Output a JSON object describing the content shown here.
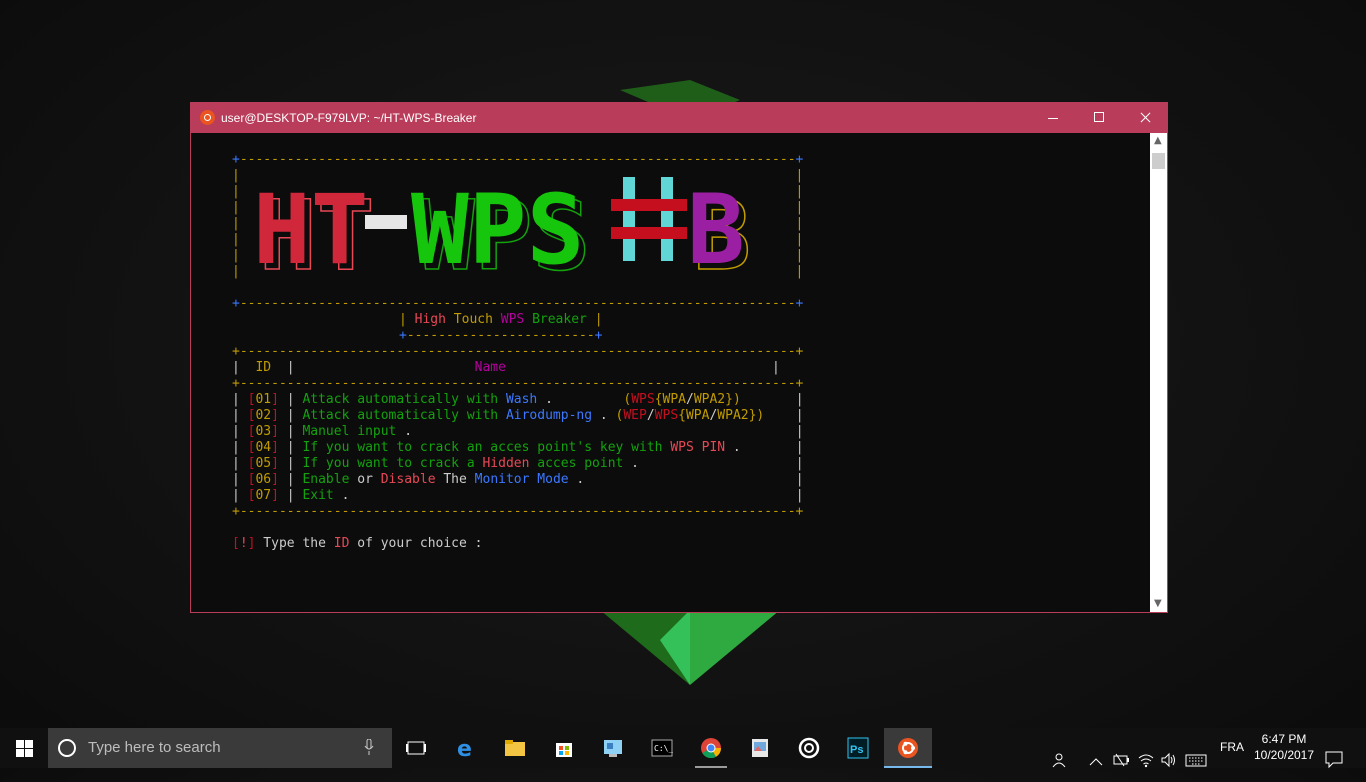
{
  "window": {
    "title": "user@DESKTOP-F979LVP: ~/HT-WPS-Breaker",
    "accent": "#b93c5a"
  },
  "terminal": {
    "banner_text": "HT-WPS#B",
    "border_top": "+-------------------------------------------------+",
    "subtitle_parts": [
      "High",
      "Touch",
      "WPS",
      "Breaker"
    ],
    "subtitle_underline": "+------------------------+",
    "table_rule": "+-------------------------------------------------+",
    "header_id": "ID",
    "header_name": "Name",
    "menu": [
      {
        "id": "01",
        "parts": [
          [
            "Attack automatically with ",
            "gr"
          ],
          [
            "Wash",
            "bl"
          ],
          [
            " .         ",
            "wh"
          ],
          [
            "(",
            "yl"
          ],
          [
            "WPS",
            "dr"
          ],
          [
            "{",
            "yl"
          ],
          [
            "WPA",
            "yl"
          ],
          [
            "/",
            "wh"
          ],
          [
            "WPA2",
            "yl"
          ],
          [
            "})",
            "yl"
          ]
        ]
      },
      {
        "id": "02",
        "parts": [
          [
            "Attack automatically with ",
            "gr"
          ],
          [
            "Airodump-ng",
            "bl"
          ],
          [
            " . ",
            "wh"
          ],
          [
            "(",
            "yl"
          ],
          [
            "WEP",
            "dr"
          ],
          [
            "/",
            "wh"
          ],
          [
            "WPS",
            "dr"
          ],
          [
            "{",
            "yl"
          ],
          [
            "WPA",
            "yl"
          ],
          [
            "/",
            "wh"
          ],
          [
            "WPA2",
            "yl"
          ],
          [
            "})",
            "yl"
          ]
        ]
      },
      {
        "id": "03",
        "parts": [
          [
            "Manuel input",
            "gr"
          ],
          [
            " .",
            "wh"
          ]
        ]
      },
      {
        "id": "04",
        "parts": [
          [
            "If you want to crack an acces point's key with ",
            "gr"
          ],
          [
            "WPS PIN",
            "rd"
          ],
          [
            " .",
            "wh"
          ]
        ]
      },
      {
        "id": "05",
        "parts": [
          [
            "If you want to crack a ",
            "gr"
          ],
          [
            "Hidden",
            "rd"
          ],
          [
            " acces point",
            "gr"
          ],
          [
            " .",
            "wh"
          ]
        ]
      },
      {
        "id": "06",
        "parts": [
          [
            "Enable",
            "gr"
          ],
          [
            " or ",
            "wh"
          ],
          [
            "Disable",
            "rd"
          ],
          [
            " The ",
            "wh"
          ],
          [
            "Monitor Mode",
            "bl"
          ],
          [
            " .",
            "wh"
          ]
        ]
      },
      {
        "id": "07",
        "parts": [
          [
            "Exit",
            "gr"
          ],
          [
            " .",
            "wh"
          ]
        ]
      }
    ],
    "prompt_bang": "!",
    "prompt_pre": " Type the ",
    "prompt_id": "ID",
    "prompt_post": " of your choice :"
  },
  "taskbar": {
    "search_placeholder": "Type here to search",
    "language": "FRA",
    "time": "6:47 PM",
    "date": "10/20/2017"
  }
}
